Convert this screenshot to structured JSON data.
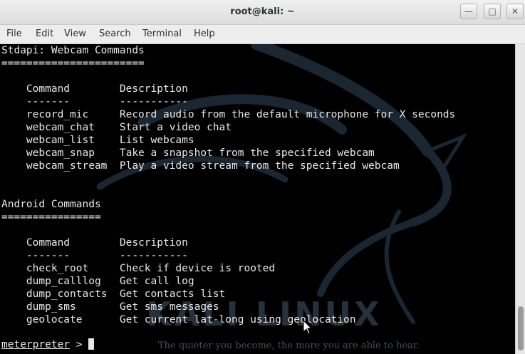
{
  "window": {
    "title": "root@kali: ~"
  },
  "menu": [
    "File",
    "Edit",
    "View",
    "Search",
    "Terminal",
    "Help"
  ],
  "terminal": {
    "lines": [
      "Stdapi: Webcam Commands",
      "=======================",
      "",
      "    Command        Description",
      "    -------        -----------",
      "    record_mic     Record audio from the default microphone for X seconds",
      "    webcam_chat    Start a video chat",
      "    webcam_list    List webcams",
      "    webcam_snap    Take a snapshot from the specified webcam",
      "    webcam_stream  Play a video stream from the specified webcam",
      "",
      "",
      "Android Commands",
      "================",
      "",
      "    Command        Description",
      "    -------        -----------",
      "    check_root     Check if device is rooted",
      "    dump_calllog   Get call log",
      "    dump_contacts  Get contacts list",
      "    dump_sms       Get sms messages",
      "    geolocate      Get current lat-long using geolocation"
    ],
    "prompt": "meterpreter",
    "prompt_suffix": " > "
  },
  "wallpaper": {
    "logo_text": "KALI LINUX",
    "tagline": "The quieter you become, the more you are able to hear."
  },
  "colors": {
    "terminal_bg": "#000000",
    "terminal_fg": "#e8e8e8",
    "chrome": "#ededed"
  },
  "icons": [
    "minimize-icon",
    "maximize-icon",
    "close-icon",
    "mouse-pointer-icon"
  ]
}
